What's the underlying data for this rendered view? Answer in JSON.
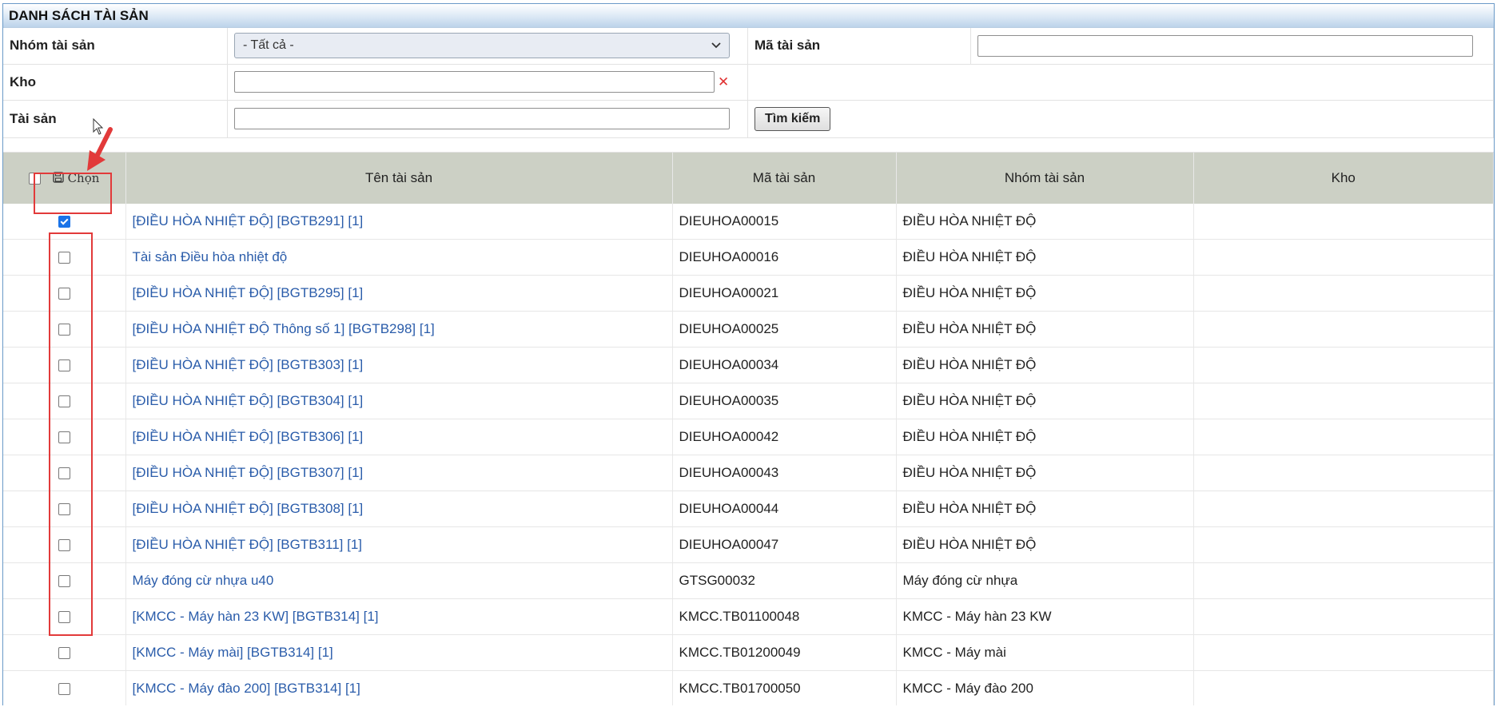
{
  "panel": {
    "title": "DANH SÁCH TÀI SẢN"
  },
  "filters": {
    "group_label": "Nhóm tài sản",
    "group_selected": "- Tất cả -",
    "code_label": "Mã tài sản",
    "code_value": "",
    "warehouse_label": "Kho",
    "warehouse_value": "",
    "clear_symbol": "✕",
    "asset_label": "Tài sản",
    "asset_value": "",
    "search_button": "Tìm kiếm"
  },
  "grid": {
    "headers": {
      "select": "Chọn",
      "name": "Tên tài sản",
      "code": "Mã tài sản",
      "group": "Nhóm tài sản",
      "warehouse": "Kho"
    },
    "rows": [
      {
        "checked": true,
        "name": "[ĐIỀU HÒA NHIỆT ĐỘ] [BGTB291] [1]",
        "code": "DIEUHOA00015",
        "group": "ĐIỀU HÒA NHIỆT ĐỘ",
        "warehouse": ""
      },
      {
        "checked": false,
        "name": "Tài sản Điều hòa nhiệt độ",
        "code": "DIEUHOA00016",
        "group": "ĐIỀU HÒA NHIỆT ĐỘ",
        "warehouse": ""
      },
      {
        "checked": false,
        "name": "[ĐIỀU HÒA NHIỆT ĐỘ] [BGTB295] [1]",
        "code": "DIEUHOA00021",
        "group": "ĐIỀU HÒA NHIỆT ĐỘ",
        "warehouse": ""
      },
      {
        "checked": false,
        "name": "[ĐIỀU HÒA NHIỆT ĐỘ Thông số 1] [BGTB298] [1]",
        "code": "DIEUHOA00025",
        "group": "ĐIỀU HÒA NHIỆT ĐỘ",
        "warehouse": ""
      },
      {
        "checked": false,
        "name": "[ĐIỀU HÒA NHIỆT ĐỘ] [BGTB303] [1]",
        "code": "DIEUHOA00034",
        "group": "ĐIỀU HÒA NHIỆT ĐỘ",
        "warehouse": ""
      },
      {
        "checked": false,
        "name": "[ĐIỀU HÒA NHIỆT ĐỘ] [BGTB304] [1]",
        "code": "DIEUHOA00035",
        "group": "ĐIỀU HÒA NHIỆT ĐỘ",
        "warehouse": ""
      },
      {
        "checked": false,
        "name": "[ĐIỀU HÒA NHIỆT ĐỘ] [BGTB306] [1]",
        "code": "DIEUHOA00042",
        "group": "ĐIỀU HÒA NHIỆT ĐỘ",
        "warehouse": ""
      },
      {
        "checked": false,
        "name": "[ĐIỀU HÒA NHIỆT ĐỘ] [BGTB307] [1]",
        "code": "DIEUHOA00043",
        "group": "ĐIỀU HÒA NHIỆT ĐỘ",
        "warehouse": ""
      },
      {
        "checked": false,
        "name": "[ĐIỀU HÒA NHIỆT ĐỘ] [BGTB308] [1]",
        "code": "DIEUHOA00044",
        "group": "ĐIỀU HÒA NHIỆT ĐỘ",
        "warehouse": ""
      },
      {
        "checked": false,
        "name": "[ĐIỀU HÒA NHIỆT ĐỘ] [BGTB311] [1]",
        "code": "DIEUHOA00047",
        "group": "ĐIỀU HÒA NHIỆT ĐỘ",
        "warehouse": ""
      },
      {
        "checked": false,
        "name": "Máy đóng cừ nhựa u40",
        "code": "GTSG00032",
        "group": "Máy đóng cừ nhựa",
        "warehouse": ""
      },
      {
        "checked": false,
        "name": "[KMCC - Máy hàn 23 KW] [BGTB314] [1]",
        "code": "KMCC.TB01100048",
        "group": "KMCC - Máy hàn 23 KW",
        "warehouse": ""
      },
      {
        "checked": false,
        "name": "[KMCC - Máy mài] [BGTB314] [1]",
        "code": "KMCC.TB01200049",
        "group": "KMCC - Máy mài",
        "warehouse": ""
      },
      {
        "checked": false,
        "name": "[KMCC - Máy đào 200] [BGTB314] [1]",
        "code": "KMCC.TB01700050",
        "group": "KMCC - Máy đào 200",
        "warehouse": ""
      }
    ]
  },
  "colors": {
    "link": "#2a5caa",
    "header_bg": "#ccd0c5",
    "highlight": "#e23a3a",
    "title_gradient_end": "#bcd3ea"
  }
}
